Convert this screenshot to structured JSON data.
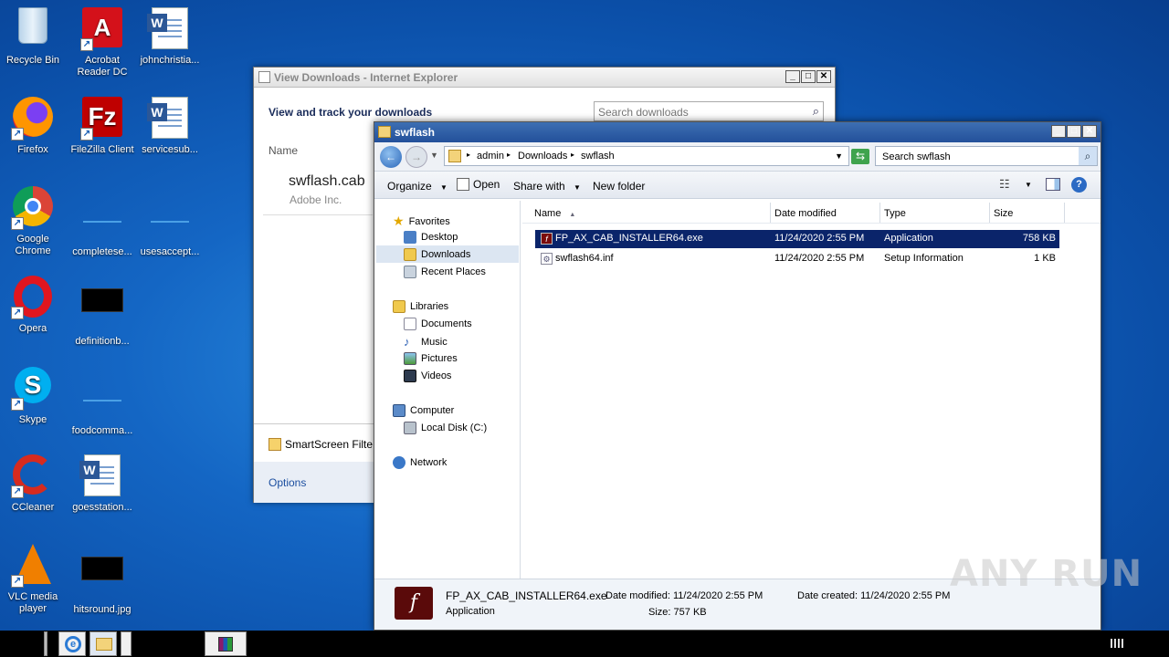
{
  "desktop": {
    "icons": [
      {
        "label": "Recycle Bin"
      },
      {
        "label": "Acrobat Reader DC"
      },
      {
        "label": "johnchristia..."
      },
      {
        "label": "Firefox"
      },
      {
        "label": "FileZilla Client"
      },
      {
        "label": "servicesub..."
      },
      {
        "label": "Google Chrome"
      },
      {
        "label": "completese..."
      },
      {
        "label": "usesaccept..."
      },
      {
        "label": "Opera"
      },
      {
        "label": "definitionb..."
      },
      {
        "label": "Skype"
      },
      {
        "label": "foodcomma..."
      },
      {
        "label": "CCleaner"
      },
      {
        "label": "goesstation..."
      },
      {
        "label": "VLC media player"
      },
      {
        "label": "hitsround.jpg"
      }
    ]
  },
  "ie_window": {
    "title": "View Downloads - Internet Explorer",
    "heading": "View and track your downloads",
    "search_placeholder": "Search downloads",
    "column_name": "Name",
    "item_name": "swflash.cab",
    "item_publisher": "Adobe Inc.",
    "smartscreen": "SmartScreen Filte",
    "options": "Options"
  },
  "explorer": {
    "title": "swflash",
    "breadcrumb": [
      "admin",
      "Downloads",
      "swflash"
    ],
    "search_placeholder": "Search swflash",
    "commands": {
      "organize": "Organize",
      "open": "Open",
      "share_with": "Share with",
      "new_folder": "New folder"
    },
    "nav": {
      "favorites": "Favorites",
      "desktop": "Desktop",
      "downloads": "Downloads",
      "recent": "Recent Places",
      "libraries": "Libraries",
      "documents": "Documents",
      "music": "Music",
      "pictures": "Pictures",
      "videos": "Videos",
      "computer": "Computer",
      "local_disk": "Local Disk (C:)",
      "network": "Network"
    },
    "columns": {
      "name": "Name",
      "date": "Date modified",
      "type": "Type",
      "size": "Size"
    },
    "files": [
      {
        "name": "FP_AX_CAB_INSTALLER64.exe",
        "date": "11/24/2020 2:55 PM",
        "type": "Application",
        "size": "758 KB"
      },
      {
        "name": "swflash64.inf",
        "date": "11/24/2020 2:55 PM",
        "type": "Setup Information",
        "size": "1 KB"
      }
    ],
    "details": {
      "filename": "FP_AX_CAB_INSTALLER64.exe",
      "filetype": "Application",
      "modified_label": "Date modified:",
      "modified_value": "11/24/2020 2:55 PM",
      "size_label": "Size:",
      "size_value": "757 KB",
      "created_label": "Date created:",
      "created_value": "11/24/2020 2:55 PM"
    }
  },
  "watermark": "ANY RUN",
  "colors": {
    "selection": "#0a246a",
    "title_active": "#23509a"
  }
}
